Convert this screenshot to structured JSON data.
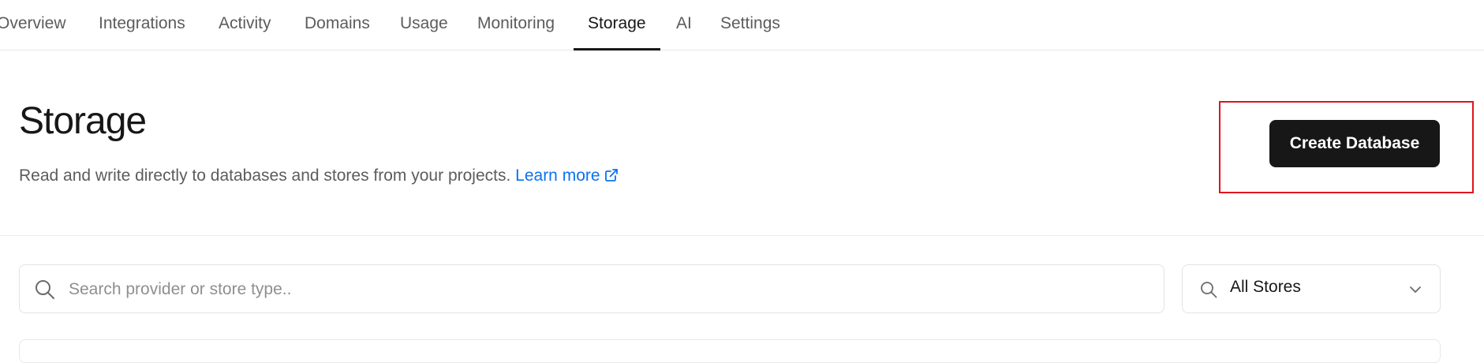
{
  "tabs": [
    {
      "label": "Overview"
    },
    {
      "label": "Integrations"
    },
    {
      "label": "Activity"
    },
    {
      "label": "Domains"
    },
    {
      "label": "Usage"
    },
    {
      "label": "Monitoring"
    },
    {
      "label": "Storage",
      "active": true
    },
    {
      "label": "AI"
    },
    {
      "label": "Settings"
    }
  ],
  "header": {
    "title": "Storage",
    "subtitle": "Read and write directly to databases and stores from your projects.",
    "learn_more": "Learn more",
    "create_button": "Create Database"
  },
  "search": {
    "placeholder": "Search provider or store type.."
  },
  "filter": {
    "selected": "All Stores"
  },
  "colors": {
    "accent_link": "#0a72ef",
    "button_bg": "#171717",
    "highlight": "#e0121f"
  },
  "icons": [
    "external-link-icon",
    "search-icon",
    "chevron-down-icon"
  ]
}
